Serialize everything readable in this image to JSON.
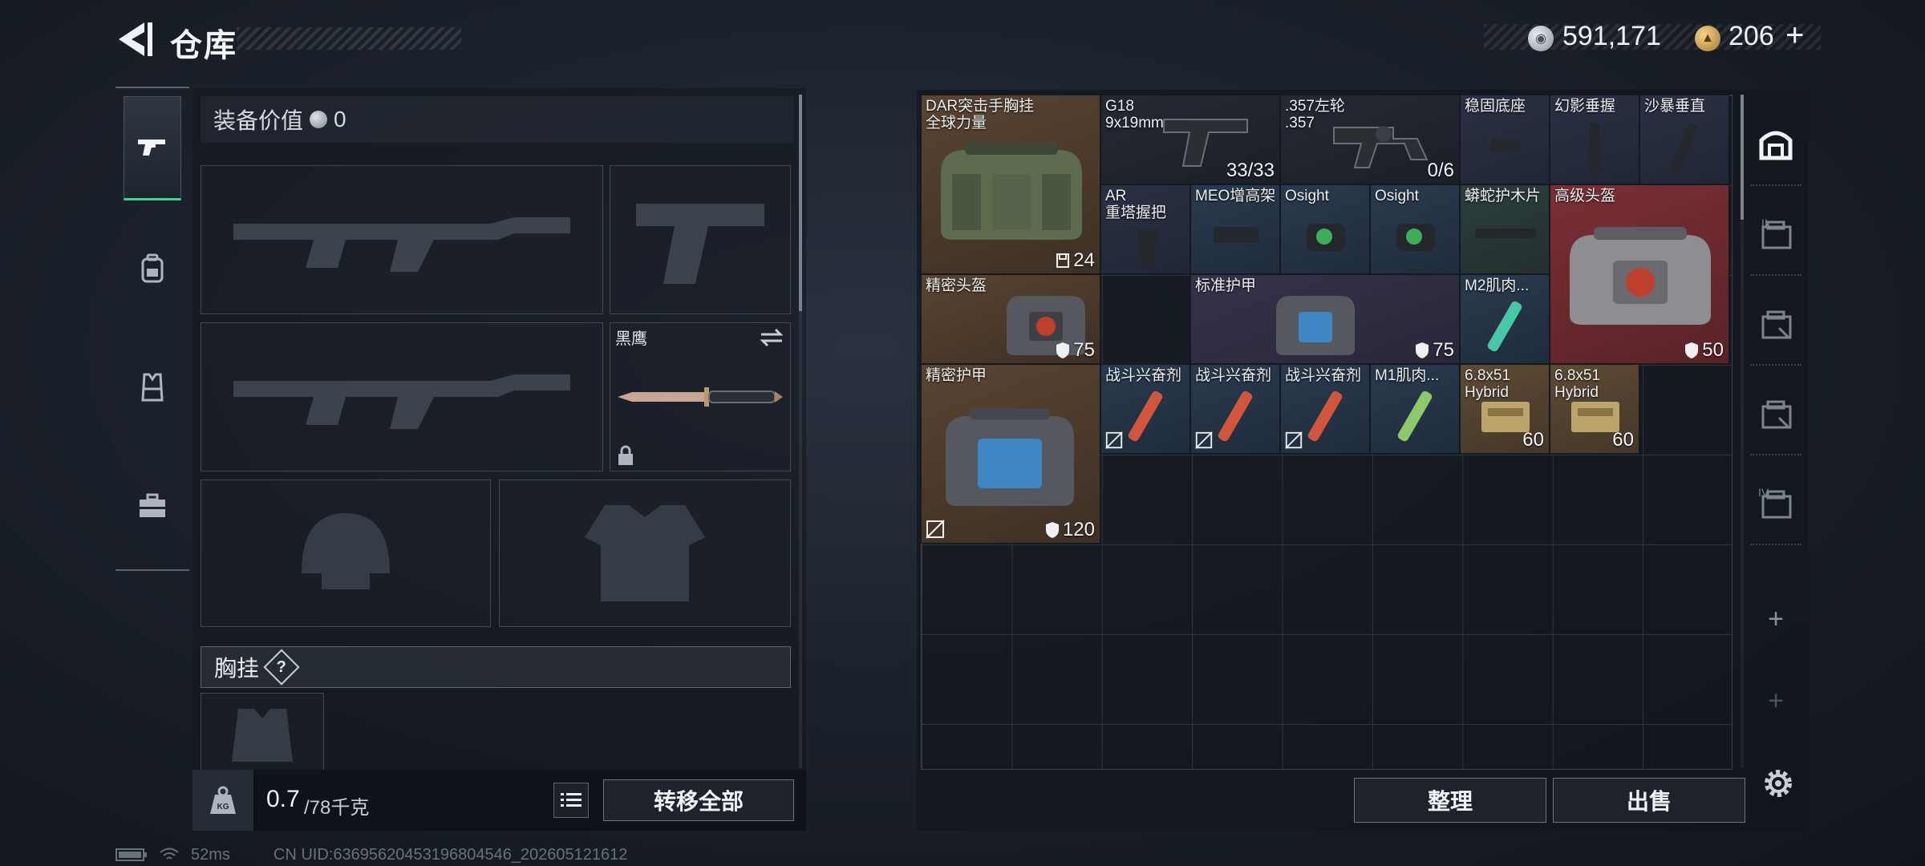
{
  "header": {
    "title": "仓库",
    "coin_amount": "591,171",
    "gold_amount": "206",
    "add_label": "+"
  },
  "sidebar_tabs": [
    {
      "icon": "pistol-icon",
      "active": true
    },
    {
      "icon": "backpack-icon",
      "active": false
    },
    {
      "icon": "vest-icon",
      "active": false
    },
    {
      "icon": "toolbox-icon",
      "active": false
    }
  ],
  "equipment": {
    "value_label": "装备价值",
    "value": "0",
    "melee_name": "黑鹰",
    "vest_label": "胸挂",
    "help_label": "?"
  },
  "capacity": {
    "current": "0.7",
    "max": "/78千克",
    "kg_label": "KG"
  },
  "buttons": {
    "transfer_all": "转移全部",
    "sort": "整理",
    "sell": "出售"
  },
  "stash_items": [
    {
      "id": "dar-rig",
      "name_line1": "DAR突击手胸挂",
      "name_line2": "全球力量",
      "count": "24"
    },
    {
      "id": "g18",
      "name_line1": "G18",
      "name_line2": "9x19mm",
      "count": "33/33"
    },
    {
      "id": "revolver",
      "name_line1": ".357左轮",
      "name_line2": ".357",
      "count": "0/6"
    },
    {
      "id": "stable-base",
      "name_line1": "稳固底座"
    },
    {
      "id": "phantom-grip",
      "name_line1": "幻影垂握"
    },
    {
      "id": "sandstorm-grip",
      "name_line1": "沙暴垂直"
    },
    {
      "id": "ar-grip",
      "name_line1": "AR",
      "name_line2": "重塔握把"
    },
    {
      "id": "meo-riser",
      "name_line1": "MEO增高架"
    },
    {
      "id": "osight-1",
      "name_line1": "Osight"
    },
    {
      "id": "osight-2",
      "name_line1": "Osight"
    },
    {
      "id": "python-panel",
      "name_line1": "蟒蛇护木片"
    },
    {
      "id": "adv-helmet",
      "name_line1": "高级头盔",
      "count": "50"
    },
    {
      "id": "precision-helmet",
      "name_line1": "精密头盔",
      "count": "75"
    },
    {
      "id": "standard-armor",
      "name_line1": "标准护甲",
      "count": "75"
    },
    {
      "id": "m2-muscle",
      "name_line1": "M2肌肉..."
    },
    {
      "id": "precision-armor",
      "name_line1": "精密护甲",
      "count": "120"
    },
    {
      "id": "stim-1",
      "name_line1": "战斗兴奋剂"
    },
    {
      "id": "stim-2",
      "name_line1": "战斗兴奋剂"
    },
    {
      "id": "stim-3",
      "name_line1": "战斗兴奋剂"
    },
    {
      "id": "m1-muscle",
      "name_line1": "M1肌肉..."
    },
    {
      "id": "ammo-68-1",
      "name_line1": "6.8x51",
      "name_line2": "Hybrid",
      "count": "60"
    },
    {
      "id": "ammo-68-2",
      "name_line1": "6.8x51",
      "name_line2": "Hybrid",
      "count": "60"
    }
  ],
  "right_tabs": [
    {
      "icon": "stash-shelf-icon",
      "label": ""
    },
    {
      "icon": "case-tier-1-icon",
      "label": "II"
    },
    {
      "icon": "case-tier-2-icon",
      "label": ""
    },
    {
      "icon": "case-tier-3-icon",
      "label": ""
    },
    {
      "icon": "case-tier-4-icon",
      "label": "IV"
    },
    {
      "icon": "add-case-icon",
      "label": "+"
    },
    {
      "icon": "add-case-locked-icon",
      "label": "+"
    }
  ],
  "status": {
    "ping": "52ms",
    "uid": "CN UID:6369562045319680454​6_202605121612"
  },
  "colors": {
    "accent_green": "#3fd58e",
    "item_red": "#7a2f36",
    "item_brown": "#5a4432"
  }
}
